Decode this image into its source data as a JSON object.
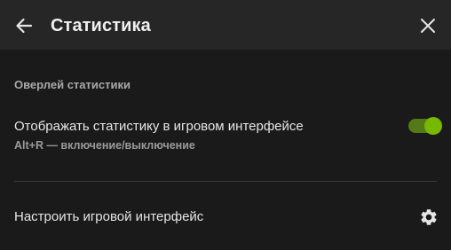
{
  "header": {
    "title": "Статистика",
    "back_icon": "arrow-left-icon",
    "close_icon": "close-icon"
  },
  "section": {
    "title": "Оверлей статистики"
  },
  "stats_toggle": {
    "label": "Отображать статистику в игровом интерфейсе",
    "hint": "Alt+R — включение/выключение",
    "enabled": true,
    "accent_color": "#76b900"
  },
  "customize": {
    "label": "Настроить игровой интерфейс",
    "icon": "gear-icon"
  }
}
